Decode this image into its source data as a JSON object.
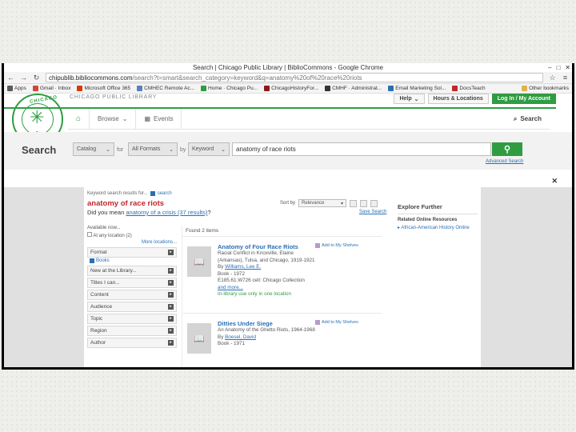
{
  "browser": {
    "title": "Search | Chicago Public Library | BiblioCommons - Google Chrome",
    "url_host": "chipublib.bibliocommons.com",
    "url_rest": "/search?t=smart&search_category=keyword&q=anatomy%20of%20race%20riots",
    "bookmarks": [
      {
        "label": "Apps",
        "color": "#5a5a5a"
      },
      {
        "label": "Gmail · Inbox",
        "color": "#d44638"
      },
      {
        "label": "Microsoft Office 365",
        "color": "#d83b01"
      },
      {
        "label": "CMHEC Remote Ac...",
        "color": "#5b7fbd"
      },
      {
        "label": "Home · Chicago Pu...",
        "color": "#2f9c42"
      },
      {
        "label": "ChicagoHistoryFor...",
        "color": "#8b1a1a"
      },
      {
        "label": "CMHF · Administrat...",
        "color": "#333333"
      },
      {
        "label": "Email Marketing Sol...",
        "color": "#2a6fb5"
      },
      {
        "label": "DocsTeach",
        "color": "#c0282d"
      },
      {
        "label": "Other bookmarks",
        "color": "#e0b34b"
      }
    ]
  },
  "site": {
    "logo_top": "CHICAGO",
    "logo_bottom": "PUBLIC LIBRARY",
    "library_name": "CHICAGO PUBLIC LIBRARY",
    "help": "Help",
    "hours": "Hours & Locations",
    "login": "Log In / My Account",
    "nav": {
      "browse": "Browse",
      "events": "Events",
      "search": "Search"
    },
    "search": {
      "label": "Search",
      "catalog": "Catalog",
      "for": "for",
      "formats": "All Formats",
      "by": "by",
      "field": "Keyword",
      "query": "anatomy of race riots",
      "advanced": "Advanced Search"
    }
  },
  "results_page": {
    "keyword_label": "Keyword search results for...",
    "search_link": "search",
    "term": "anatomy of race riots",
    "did_you_mean_prefix": "Did you mean",
    "did_you_mean_link": "anatomy of a crisis (37 results)",
    "did_you_mean_suffix": "?",
    "sort_by": "Sort by",
    "sort_value": "Relevance",
    "save_search": "Save Search",
    "found": "Found 2 items",
    "facets": {
      "available_now": "Available now...",
      "at_any_location": "At any location",
      "at_any_location_count": "(2)",
      "more_locations": "More locations...",
      "items": [
        "Format",
        "New at the Library...",
        "Titles I can...",
        "Content",
        "Audience",
        "Topic",
        "Region",
        "Author"
      ],
      "format_value": "Books"
    },
    "results": [
      {
        "title": "Anatomy of Four Race Riots",
        "subtitle": "Racial Conflict in Knoxville, Elaine (Arkansas), Tulsa, and Chicago, 1919-1921",
        "author_prefix": "By",
        "author": "Williams, Lee E.",
        "format": "Book - 1972",
        "callnum": "E185.61.W726 cell: Chicago Collection",
        "more": "and more...",
        "availability": "In-library use only in one location",
        "shelf": "Add to My Shelves"
      },
      {
        "title": "Ditties Under Siege",
        "subtitle": "An Anatomy of the Ghetto Riots, 1964-1968",
        "author_prefix": "By",
        "author": "Boesel, David",
        "format": "Book - 1971",
        "shelf": "Add to My Shelves"
      }
    ],
    "aside": {
      "heading": "Explore Further",
      "resources_heading": "Related Online Resources",
      "link": "African-American History Online"
    }
  }
}
